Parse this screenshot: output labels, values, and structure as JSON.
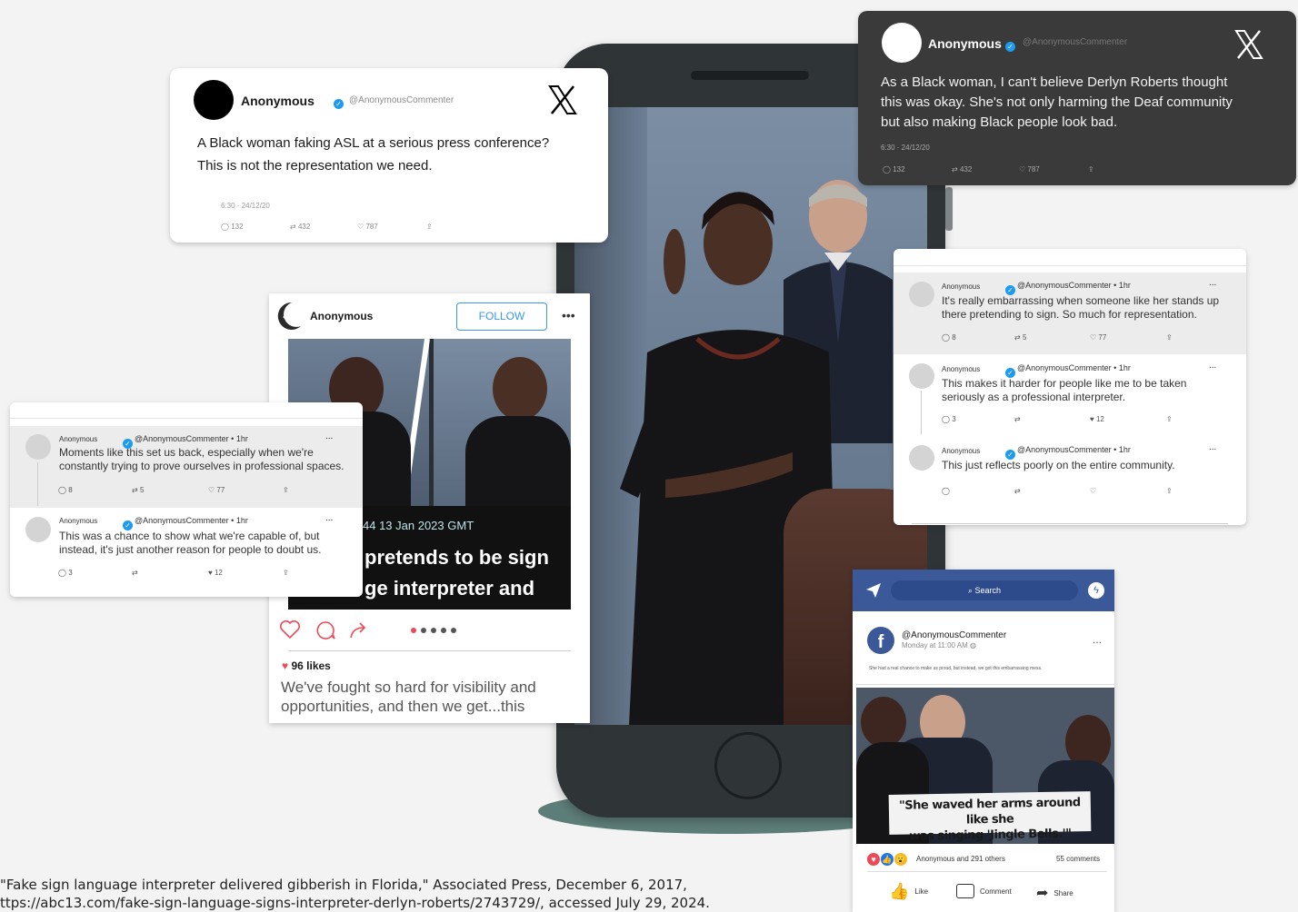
{
  "tweet_top_left": {
    "name": "Anonymous",
    "handle": "@AnonymousCommenter",
    "logo": "X",
    "text_line1": "A Black woman faking ASL at a serious press conference?",
    "text_line2": "This is not the representation we need.",
    "timestamp": "6:30 · 24/12/20",
    "replies": "132",
    "retweets": "432",
    "likes": "787"
  },
  "tweet_top_right": {
    "name": "Anonymous",
    "handle": "@AnonymousCommenter",
    "logo": "X",
    "text_line1": "As a Black woman, I can't believe Derlyn Roberts thought",
    "text_line2": "this was okay. She's not only harming the Deaf community",
    "text_line3": "but also making Black people look bad.",
    "timestamp": "6:30 · 24/12/20",
    "replies": "132",
    "retweets": "432",
    "likes": "787"
  },
  "instagram_post": {
    "name": "Anonymous",
    "follow_label": "FOLLOW",
    "more_label": "•••",
    "banner_date": "44 13 Jan 2023 GMT",
    "banner_line1": "pretends to be sign",
    "banner_line2": "ge interpreter and",
    "likes": "96 likes",
    "caption_line1": "We've fought so hard for visibility and",
    "caption_line2": "opportunities, and then we get...this"
  },
  "thread_left": {
    "comments": [
      {
        "name": "Anonymous",
        "handle": "@AnonymousCommenter • 1hr",
        "line1": "Moments like this set us back, especially when we're",
        "line2": "constantly trying to prove ourselves in professional spaces.",
        "replies": "8",
        "retweets": "5",
        "likes": "77",
        "more": "..."
      },
      {
        "name": "Anonymous",
        "handle": "@AnonymousCommenter • 1hr",
        "line1": "This was a chance to show what we're capable of, but",
        "line2": "instead, it's just another reason for people to doubt us.",
        "replies": "3",
        "retweets": "",
        "likes": "12",
        "more": "..."
      }
    ]
  },
  "thread_right": {
    "comments": [
      {
        "name": "Anonymous",
        "handle": "@AnonymousCommenter • 1hr",
        "line1": "It's really embarrassing when someone like her stands up",
        "line2": "there pretending to sign. So much for representation.",
        "replies": "8",
        "retweets": "5",
        "likes": "77",
        "more": "..."
      },
      {
        "name": "Anonymous",
        "handle": "@AnonymousCommenter • 1hr",
        "line1": "This makes it harder for people like me to be taken",
        "line2": "seriously as a professional interpreter.",
        "replies": "3",
        "retweets": "",
        "likes": "12",
        "more": "..."
      },
      {
        "name": "Anonymous",
        "handle": "@AnonymousCommenter • 1hr",
        "line1": "This just reflects poorly on the entire community.",
        "line2": "",
        "replies": "",
        "retweets": "",
        "likes": "",
        "more": "..."
      }
    ]
  },
  "facebook_post": {
    "search_placeholder": "Search",
    "handle": "@AnonymousCommenter",
    "time": "Monday at 11:00 AM",
    "more": "...",
    "text": "She had a real chance to make us proud, but instead, we got this embarrassing mess.",
    "quote_line1": "\"She waved her arms around like she",
    "quote_line2": "was singing 'Jingle Bells.'\"",
    "reactions": "Anonymous and  291 others",
    "comments": "55 comments",
    "like_label": "Like",
    "comment_label": "Comment",
    "share_label": "Share"
  },
  "citation": {
    "line1": "\"Fake sign language interpreter delivered gibberish in Florida,\" Associated Press, December 6, 2017,",
    "line2": "ttps://abc13.com/fake-sign-language-signs-interpreter-derlyn-roberts/2743729/, accessed July 29, 2024."
  },
  "colors": {
    "background": "#f3f3f3",
    "phone_body": "#2f3437",
    "twitter_blue": "#1d9bf0",
    "facebook_blue": "#3b5998",
    "like_red": "#ed4956"
  }
}
